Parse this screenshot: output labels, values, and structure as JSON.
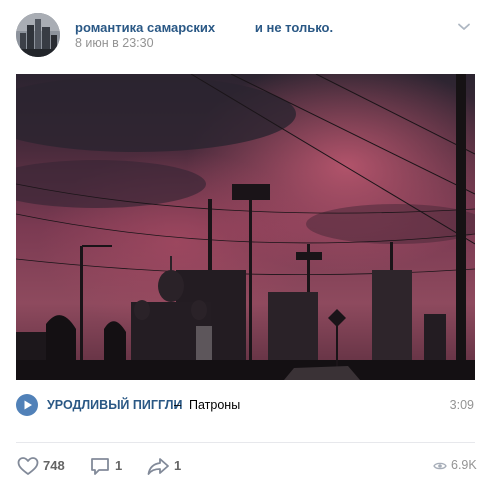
{
  "post": {
    "group_name": "романтика самарских           и не только.",
    "date": "8 июн в 23:30",
    "avatar_icon": "city-skyline-avatar",
    "menu_icon": "chevron-down-icon"
  },
  "photo": {
    "description_icon": "sunset-city-photo"
  },
  "audio": {
    "play_icon": "play-icon",
    "artist": "УРОДЛИВЫЙ ПИГГЛИ",
    "separator": "–",
    "title": "Патроны",
    "duration": "3:09"
  },
  "actions": {
    "likes": "748",
    "comments": "1",
    "shares": "1",
    "views": "6.9K"
  },
  "colors": {
    "link": "#2a5885",
    "accent": "#5181b8",
    "muted": "#939393",
    "icon": "#828a99"
  }
}
